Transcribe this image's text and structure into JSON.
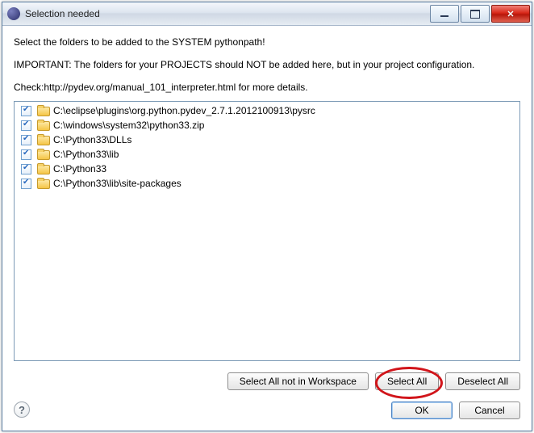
{
  "window": {
    "title": "Selection needed"
  },
  "messages": {
    "line1": "Select the folders to be added to the SYSTEM pythonpath!",
    "line2": "IMPORTANT: The folders for your PROJECTS should NOT be added here, but in your project configuration.",
    "line3": "Check:http://pydev.org/manual_101_interpreter.html for more details."
  },
  "items": [
    "C:\\eclipse\\plugins\\org.python.pydev_2.7.1.2012100913\\pysrc",
    "C:\\windows\\system32\\python33.zip",
    "C:\\Python33\\DLLs",
    "C:\\Python33\\lib",
    "C:\\Python33",
    "C:\\Python33\\lib\\site-packages"
  ],
  "buttons": {
    "selectNotWorkspace": "Select All not in Workspace",
    "selectAll": "Select All",
    "deselectAll": "Deselect All",
    "ok": "OK",
    "cancel": "Cancel"
  }
}
